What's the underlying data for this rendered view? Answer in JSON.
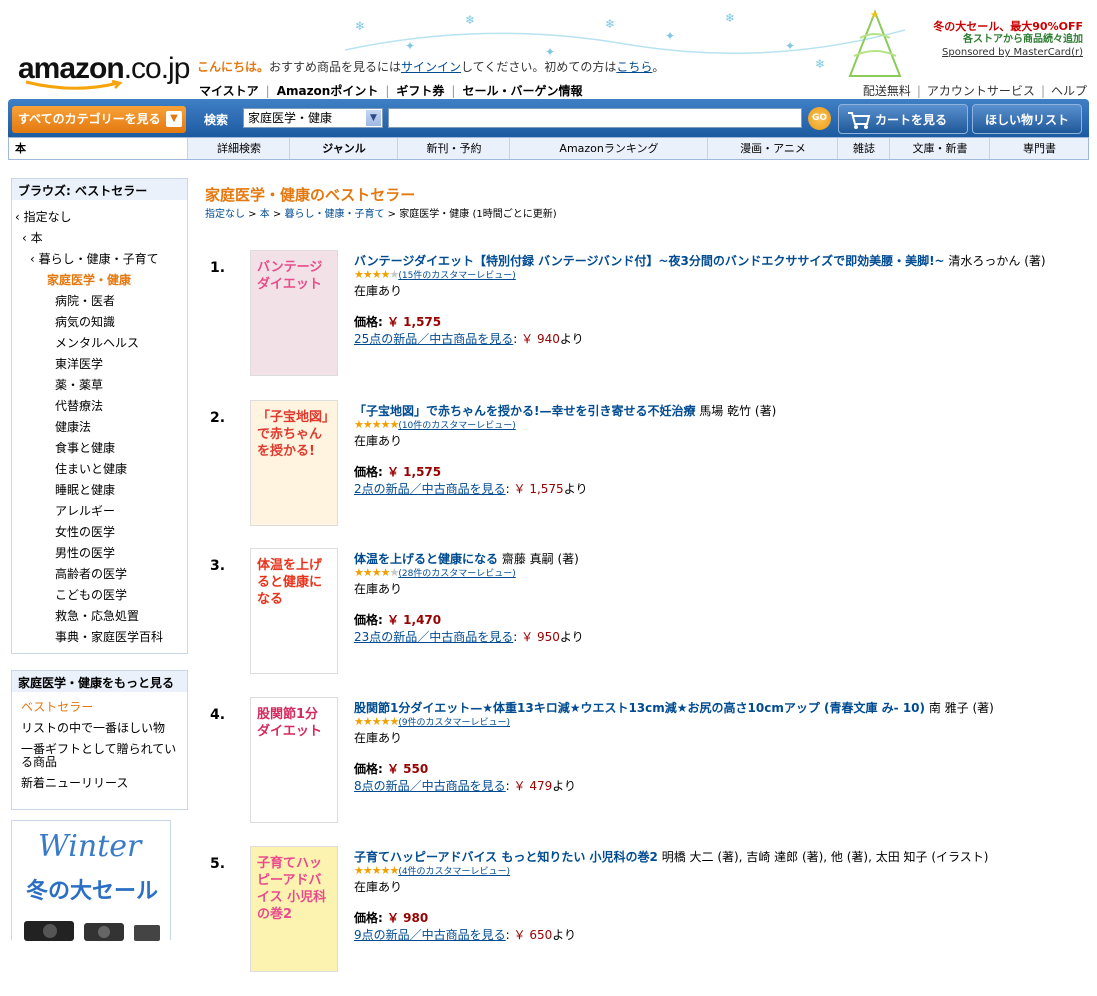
{
  "header": {
    "logo_main": "amazon",
    "logo_suffix": ".co.jp",
    "greeting_hello": "こんにちは。",
    "greeting_text1": "おすすめ商品を見るには",
    "greeting_signin": "サインイン",
    "greeting_text2": "してください。初めての方は",
    "greeting_here": "こちら",
    "greeting_text3": "。",
    "topnav": [
      "マイストア",
      "Amazonポイント",
      "ギフト券",
      "セール・バーゲン情報"
    ],
    "rightnav": [
      "配送無料",
      "アカウントサービス",
      "ヘルプ"
    ],
    "promo_line1": "冬の大セール、最大90%OFF",
    "promo_line2": "各ストアから商品続々追加",
    "promo_line3": "Sponsored by MasterCard(r)"
  },
  "search": {
    "category_button": "すべてのカテゴリーを見る",
    "label": "検索",
    "selected_category": "家庭医学・健康",
    "go_label": "GO",
    "cart_label": "カートを見る",
    "wishlist_label": "ほしい物リスト"
  },
  "subnav": {
    "home": "本",
    "items": [
      "詳細検索",
      "ジャンル",
      "新刊・予約",
      "Amazonランキング",
      "漫画・アニメ",
      "雑誌",
      "文庫・新書",
      "専門書"
    ]
  },
  "browse": {
    "title": "ブラウズ: ベストセラー",
    "items": [
      {
        "label": "‹ 指定なし"
      },
      {
        "label": "‹ 本"
      },
      {
        "label": "‹ 暮らし・健康・子育て"
      },
      {
        "label": "家庭医学・健康"
      },
      {
        "label": "病院・医者"
      },
      {
        "label": "病気の知識"
      },
      {
        "label": "メンタルヘルス"
      },
      {
        "label": "東洋医学"
      },
      {
        "label": "薬・薬草"
      },
      {
        "label": "代替療法"
      },
      {
        "label": "健康法"
      },
      {
        "label": "食事と健康"
      },
      {
        "label": "住まいと健康"
      },
      {
        "label": "睡眠と健康"
      },
      {
        "label": "アレルギー"
      },
      {
        "label": "女性の医学"
      },
      {
        "label": "男性の医学"
      },
      {
        "label": "高齢者の医学"
      },
      {
        "label": "こどもの医学"
      },
      {
        "label": "救急・応急処置"
      },
      {
        "label": "事典・家庭医学百科"
      }
    ]
  },
  "more": {
    "title": "家庭医学・健康をもっと見る",
    "items": [
      "ベストセラー",
      "リストの中で一番ほしい物",
      "一番ギフトとして贈られている商品",
      "新着ニューリリース"
    ]
  },
  "winter_banner": {
    "line1": "Winter",
    "line2": "冬の大セール"
  },
  "main": {
    "title": "家庭医学・健康のベストセラー",
    "breadcrumb": {
      "c1": "指定なし",
      "c2": "本",
      "c3": "暮らし・健康・子育て",
      "current": "家庭医学・健康",
      "note": "(1時間ごとに更新)",
      "sep": " > "
    }
  },
  "products": [
    {
      "rank": "1.",
      "title": "バンテージダイエット【特別付録 バンテージバンド付】~夜3分間のバンドエクササイズで即効美腰・美脚!~",
      "author": " 清水ろっかん (著)",
      "stars": 4,
      "reviews": "(15件のカスタマーレビュー)",
      "stock": "在庫あり",
      "price_label": "価格:",
      "price": "￥ 1,575",
      "offers": "25点の新品／中古商品を見る",
      "offers_sep": ":",
      "offers_price": "￥ 940",
      "offers_suffix": "より"
    },
    {
      "rank": "2.",
      "title": "「子宝地図」で赤ちゃんを授かる!—幸せを引き寄せる不妊治療",
      "author": " 馬場 乾竹 (著)",
      "stars": 5,
      "reviews": "(10件のカスタマーレビュー)",
      "stock": "在庫あり",
      "price_label": "価格:",
      "price": "￥ 1,575",
      "offers": "2点の新品／中古商品を見る",
      "offers_sep": ":",
      "offers_price": "￥ 1,575",
      "offers_suffix": "より"
    },
    {
      "rank": "3.",
      "title": "体温を上げると健康になる",
      "author": " 齋藤 真嗣 (著)",
      "stars": 4,
      "reviews": "(28件のカスタマーレビュー)",
      "stock": "在庫あり",
      "price_label": "価格:",
      "price": "￥ 1,470",
      "offers": "23点の新品／中古商品を見る",
      "offers_sep": ":",
      "offers_price": "￥ 950",
      "offers_suffix": "より"
    },
    {
      "rank": "4.",
      "title": "股関節1分ダイエット—★体重13キロ減★ウエスト13cm減★お尻の高さ10cmアップ (青春文庫 み- 10)",
      "author": " 南 雅子 (著)",
      "stars": 4.5,
      "reviews": "(9件のカスタマーレビュー)",
      "stock": "在庫あり",
      "price_label": "価格:",
      "price": "￥ 550",
      "offers": "8点の新品／中古商品を見る",
      "offers_sep": ":",
      "offers_price": "￥ 479",
      "offers_suffix": "より"
    },
    {
      "rank": "5.",
      "title": "子育てハッピーアドバイス もっと知りたい 小児科の巻2",
      "author": " 明橋 大二 (著), 吉崎 達郎 (著), 他 (著), 太田 知子 (イラスト)",
      "stars": 5,
      "reviews": "(4件のカスタマーレビュー)",
      "stock": "在庫あり",
      "price_label": "価格:",
      "price": "￥ 980",
      "offers": "9点の新品／中古商品を見る",
      "offers_sep": ":",
      "offers_price": "￥ 650",
      "offers_suffix": "より"
    }
  ],
  "covers": [
    {
      "text": "バンテージダイエット",
      "bg": "#F2E2E8",
      "accent": "#E84C8A"
    },
    {
      "text": "「子宝地図」で赤ちゃんを授かる!",
      "bg": "#FFF4E0",
      "accent": "#E03A2E"
    },
    {
      "text": "体温を上げると健康になる",
      "bg": "#FFFFFF",
      "accent": "#E8341C"
    },
    {
      "text": "股関節1分ダイエット",
      "bg": "#FFFFFF",
      "accent": "#D42A5E"
    },
    {
      "text": "子育てハッピーアドバイス 小児科の巻2",
      "bg": "#FDF3B0",
      "accent": "#E94B8E"
    }
  ],
  "colors": {
    "accent": "#E47911",
    "link": "#004B91",
    "price": "#990000",
    "nav": "#2E6DB4"
  }
}
